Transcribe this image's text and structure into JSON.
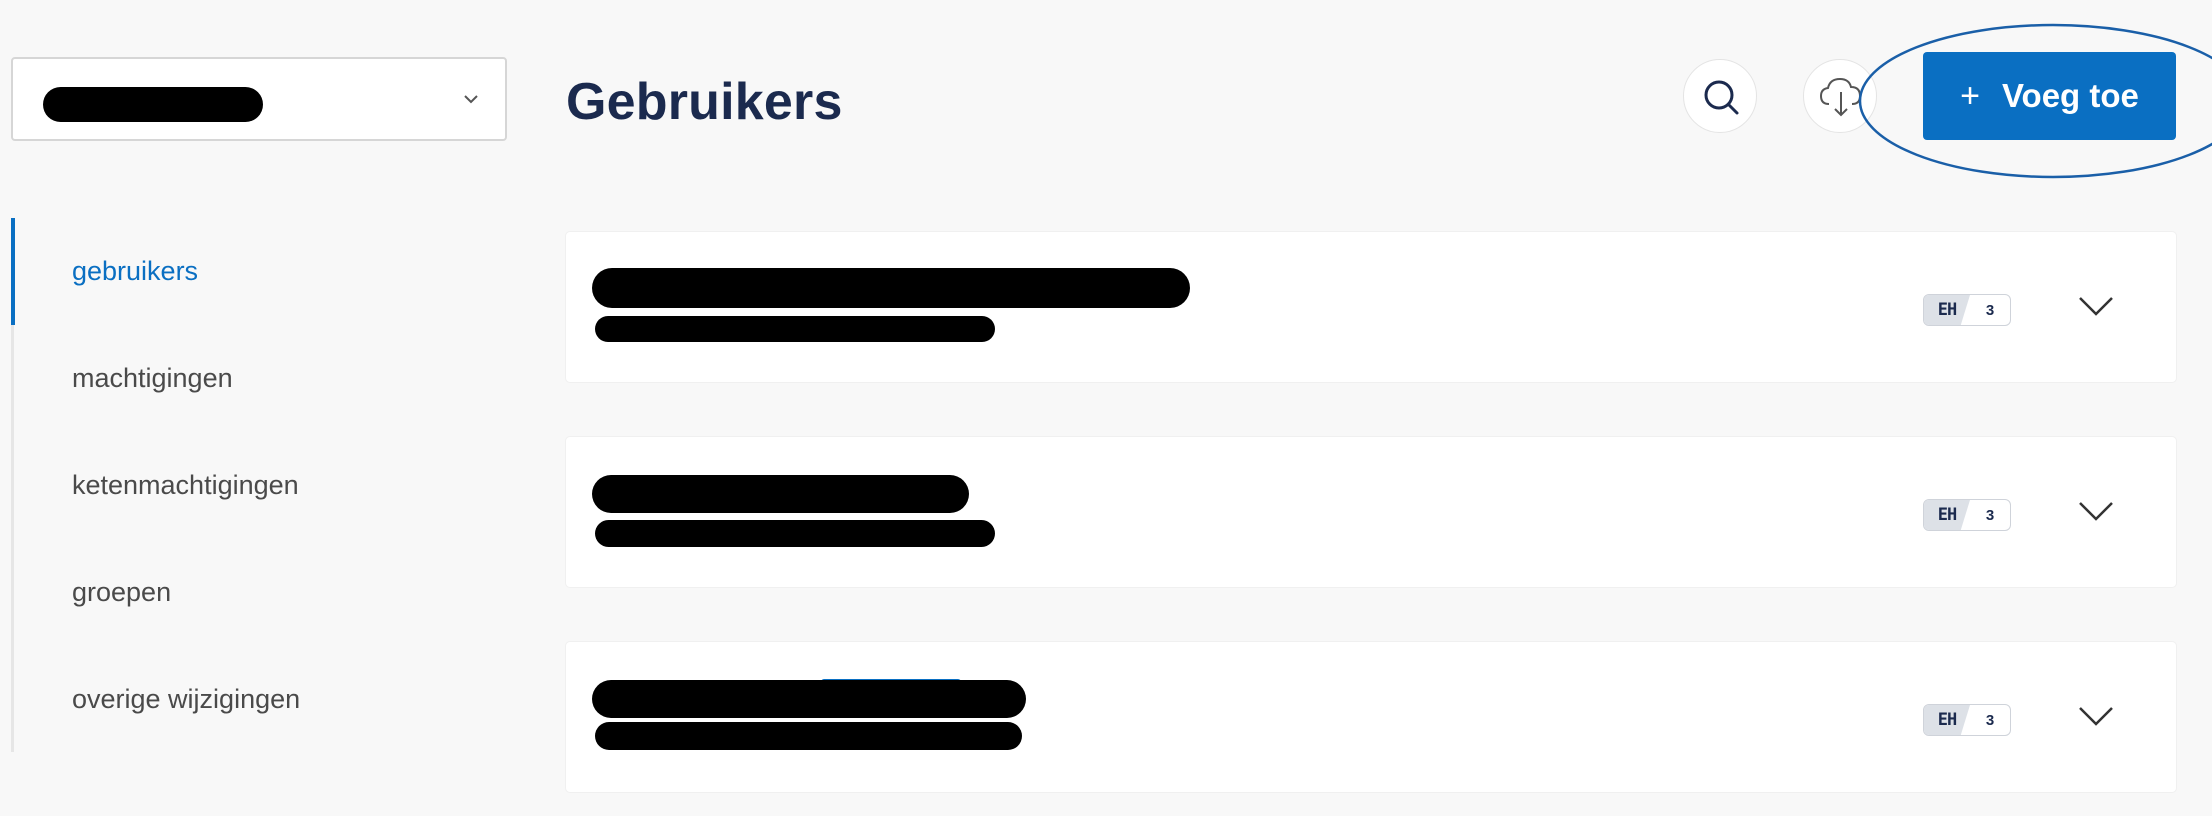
{
  "header": {
    "title": "Gebruikers",
    "add_button_label": "Voeg toe",
    "add_button_icon": "+",
    "icons": {
      "search": "search-icon",
      "download": "cloud-download-icon"
    }
  },
  "sidebar": {
    "items": [
      {
        "label": "gebruikers",
        "active": true
      },
      {
        "label": "machtigingen",
        "active": false
      },
      {
        "label": "ketenmachtigingen",
        "active": false
      },
      {
        "label": "groepen",
        "active": false
      },
      {
        "label": "overige wijzigingen",
        "active": false
      }
    ]
  },
  "users": [
    {
      "badge_code": "EH",
      "badge_count": "3"
    },
    {
      "badge_code": "EH",
      "badge_count": "3"
    },
    {
      "badge_code": "EH",
      "badge_count": "3"
    }
  ],
  "colors": {
    "accent": "#0a6fc2",
    "title": "#1b2a4e",
    "background": "#f8f8f8"
  }
}
